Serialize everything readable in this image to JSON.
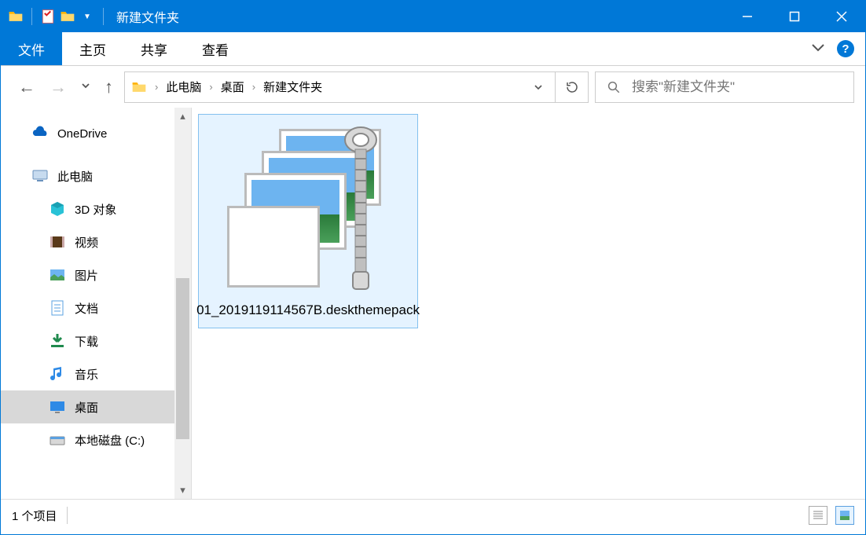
{
  "window": {
    "title": "新建文件夹"
  },
  "ribbon": {
    "file": "文件",
    "tabs": [
      "主页",
      "共享",
      "查看"
    ]
  },
  "address": {
    "crumbs": [
      "此电脑",
      "桌面",
      "新建文件夹"
    ]
  },
  "search": {
    "placeholder": "搜索\"新建文件夹\""
  },
  "sidebar": {
    "items": [
      {
        "label": "OneDrive",
        "icon": "onedrive-icon",
        "indent": 0
      },
      {
        "label": "此电脑",
        "icon": "pc-icon",
        "indent": 0
      },
      {
        "label": "3D 对象",
        "icon": "3d-icon",
        "indent": 1
      },
      {
        "label": "视频",
        "icon": "video-icon",
        "indent": 1
      },
      {
        "label": "图片",
        "icon": "pictures-icon",
        "indent": 1
      },
      {
        "label": "文档",
        "icon": "documents-icon",
        "indent": 1
      },
      {
        "label": "下载",
        "icon": "downloads-icon",
        "indent": 1
      },
      {
        "label": "音乐",
        "icon": "music-icon",
        "indent": 1
      },
      {
        "label": "桌面",
        "icon": "desktop-icon",
        "indent": 1,
        "selected": true
      },
      {
        "label": "本地磁盘 (C:)",
        "icon": "disk-icon",
        "indent": 1
      }
    ]
  },
  "files": [
    {
      "name": "01_2019119114567B.deskthemepack"
    }
  ],
  "status": {
    "text": "1 个项目"
  }
}
